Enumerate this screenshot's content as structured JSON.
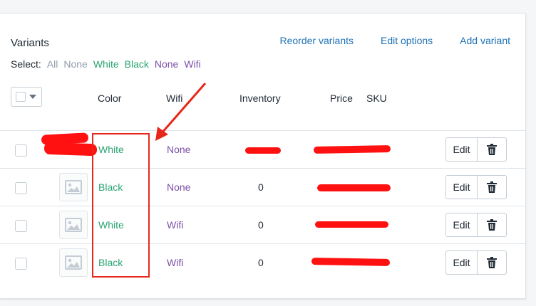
{
  "card": {
    "title": "Variants",
    "actions": [
      "Reorder variants",
      "Edit options",
      "Add variant"
    ]
  },
  "select_bar": {
    "label": "Select:",
    "options": [
      {
        "label": "All",
        "color": "#919eab"
      },
      {
        "label": "None",
        "color": "#919eab"
      },
      {
        "label": "White",
        "color": "#2aa472"
      },
      {
        "label": "Black",
        "color": "#2aa472"
      },
      {
        "label": "None",
        "color": "#7b4fa8"
      },
      {
        "label": "Wifi",
        "color": "#7b4fa8"
      }
    ]
  },
  "table": {
    "columns": [
      "Color",
      "Wifi",
      "Inventory",
      "Price",
      "SKU"
    ],
    "rows": [
      {
        "color": "White",
        "wifi": "None",
        "inventory": "",
        "edit_label": "Edit"
      },
      {
        "color": "Black",
        "wifi": "None",
        "inventory": "0",
        "edit_label": "Edit"
      },
      {
        "color": "White",
        "wifi": "Wifi",
        "inventory": "0",
        "edit_label": "Edit"
      },
      {
        "color": "Black",
        "wifi": "Wifi",
        "inventory": "0",
        "edit_label": "Edit"
      }
    ]
  },
  "icons": {
    "image_placeholder": "image-icon",
    "delete": "trash-icon",
    "dropdown": "chevron-down-icon"
  },
  "annotation_color": "#e8271c",
  "redaction_color": "#ff1111"
}
